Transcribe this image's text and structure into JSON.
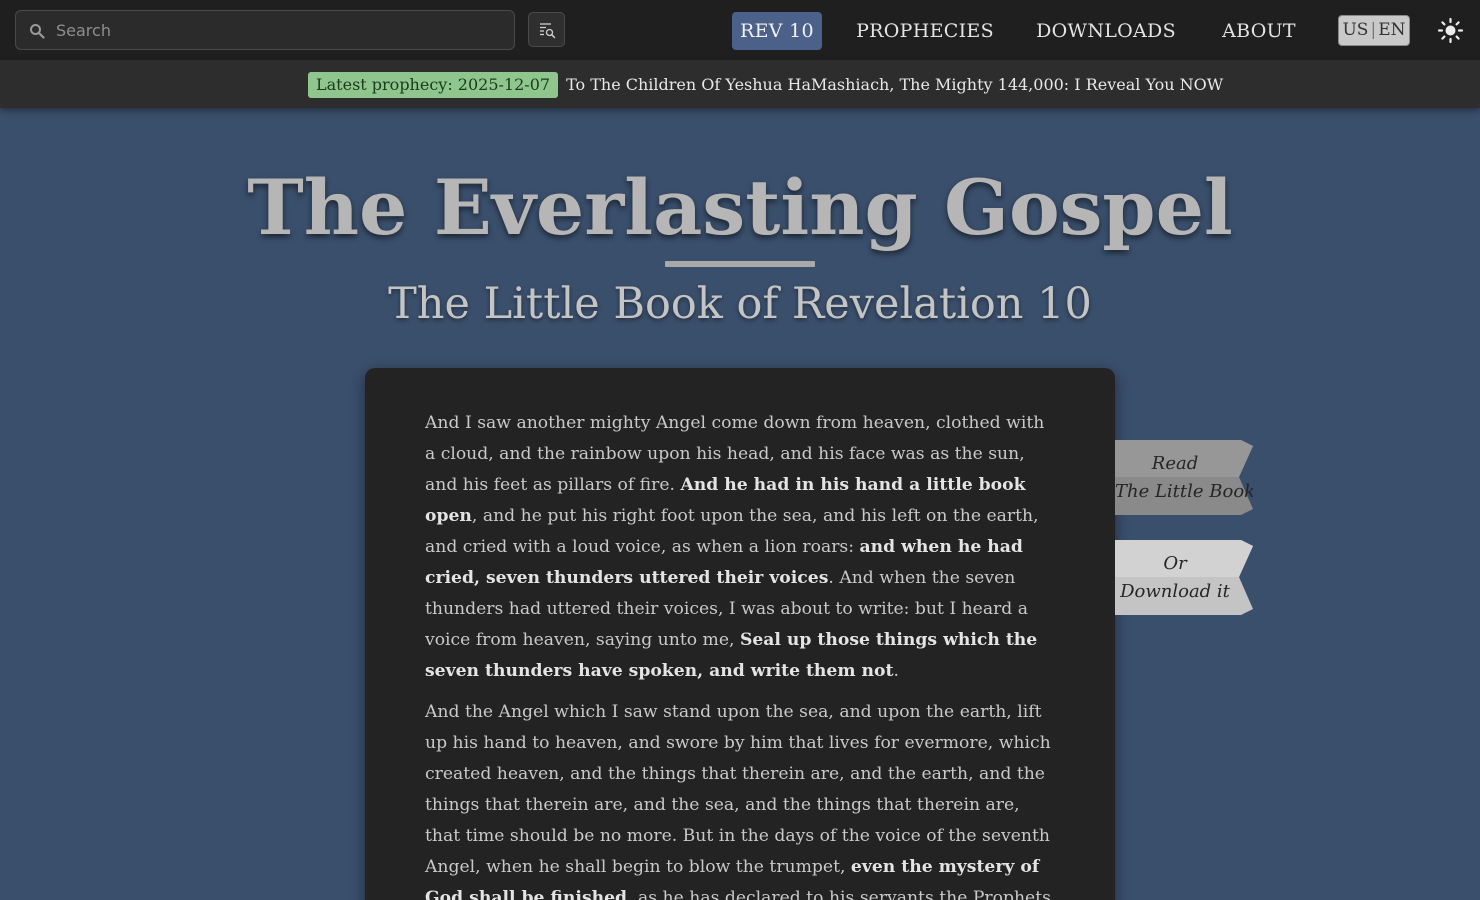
{
  "search": {
    "placeholder": "Search"
  },
  "nav": {
    "items": [
      {
        "label": "REV 10",
        "active": true
      },
      {
        "label": "PROPHECIES",
        "active": false
      },
      {
        "label": "DOWNLOADS",
        "active": false
      },
      {
        "label": "ABOUT",
        "active": false
      }
    ],
    "lang_country": "US",
    "lang_code": "EN"
  },
  "announcement": {
    "badge": "Latest prophecy: 2025-12-07",
    "title": "To The Children Of Yeshua HaMashiach, The Mighty 144,000: I Reveal You NOW"
  },
  "hero": {
    "title": "The Everlasting Gospel",
    "subtitle": "The Little Book of Revelation 10"
  },
  "passage": {
    "p1": [
      {
        "text": "And I saw another mighty Angel come down from heaven, clothed with a cloud, and the rainbow upon his head, and his face was as the sun, and his feet as pillars of fire. ",
        "bold": false
      },
      {
        "text": "And he had in his hand a little book open",
        "bold": true
      },
      {
        "text": ", and he put his right foot upon the sea, and his left on the earth, and cried with a loud voice, as when a lion roars: ",
        "bold": false
      },
      {
        "text": "and when he had cried, seven thunders uttered their voices",
        "bold": true
      },
      {
        "text": ". And when the seven thunders had uttered their voices, I was about to write: but I heard a voice from heaven, saying unto me, ",
        "bold": false
      },
      {
        "text": "Seal up those things which the seven thunders have spoken, and write them not",
        "bold": true
      },
      {
        "text": ".",
        "bold": false
      }
    ],
    "p2": [
      {
        "text": "And the Angel which I saw stand upon the sea, and upon the earth, lift up his hand to heaven, and swore by him that lives for evermore, which created heaven, and the things that therein are, and the earth, and the things that therein are, and the sea, and the things that therein are, that time should be no more. But in the days of the voice of the seventh Angel, when he shall begin to blow the trumpet, ",
        "bold": false
      },
      {
        "text": "even the mystery of God shall be finished",
        "bold": true
      },
      {
        "text": ", as he has declared to his servants the Prophets.",
        "bold": false
      }
    ]
  },
  "ribbons": {
    "read_line1": "Read",
    "read_line2": "The Little Book",
    "download_line1": "Or",
    "download_line2": "Download it"
  },
  "colors": {
    "background": "#3a4f6c",
    "topbar": "#1f1f1f",
    "nav_active": "#4b6189",
    "badge": "#8fc68e",
    "card": "#232323",
    "ribbon_read": "#8a8a8a",
    "ribbon_download": "#cdcdcd"
  },
  "icons": {
    "search": "search-icon",
    "advanced_search": "advanced-search-icon",
    "theme": "sun-icon"
  }
}
